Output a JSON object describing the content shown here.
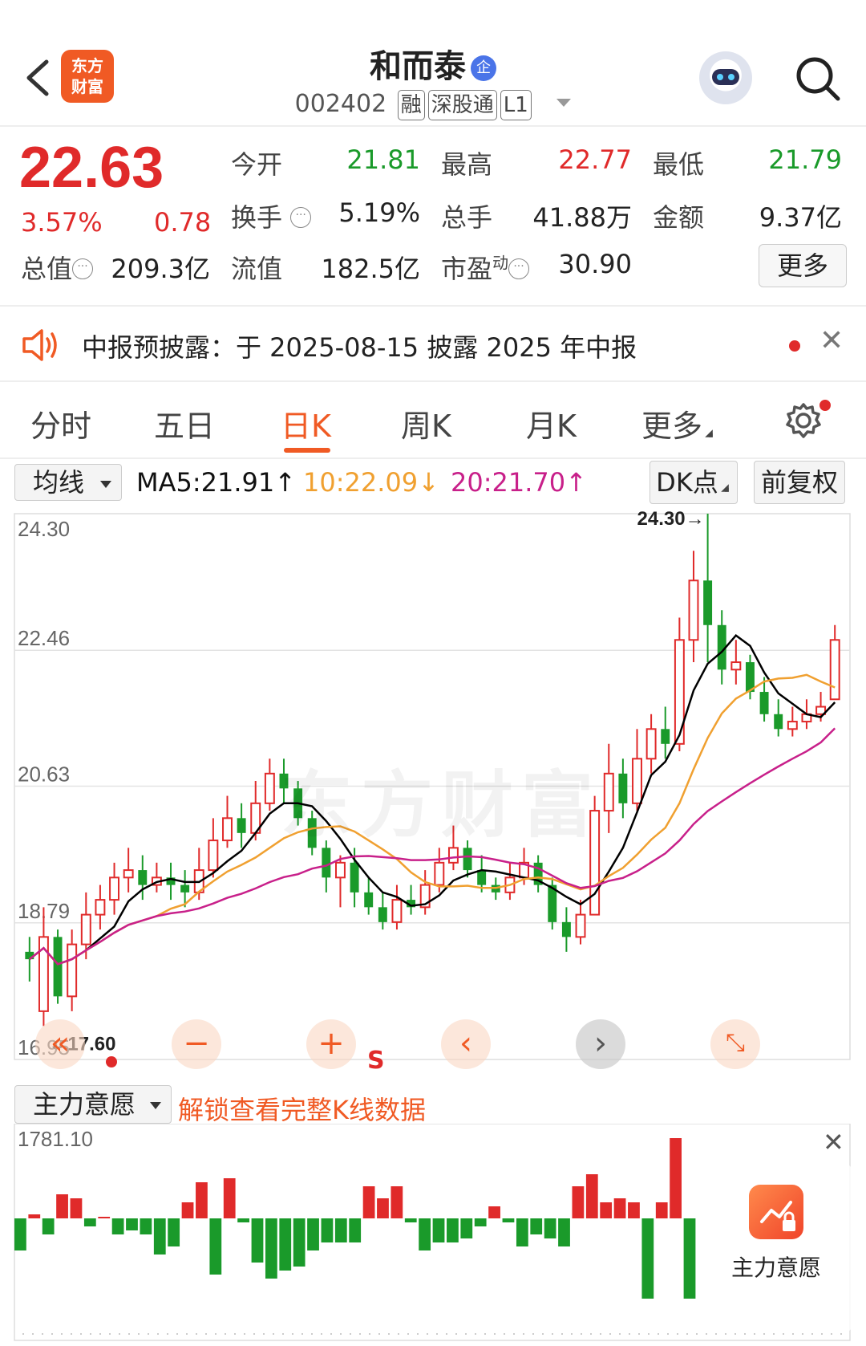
{
  "header": {
    "logo_text": "东方财富",
    "stock_name": "和而泰",
    "qi_badge": "企",
    "code": "002402",
    "tags": [
      "融",
      "深股通",
      "L1"
    ]
  },
  "quote": {
    "price": "22.63",
    "change_pct": "3.57%",
    "change": "0.78",
    "open_label": "今开",
    "open_value": "21.81",
    "high_label": "最高",
    "high_value": "22.77",
    "low_label": "最低",
    "low_value": "21.79",
    "turnover_label": "换手",
    "turnover_value": "5.19%",
    "volume_label": "总手",
    "volume_value": "41.88万",
    "amount_label": "金额",
    "amount_value": "9.37亿",
    "mktcap_label": "总值",
    "mktcap_value": "209.3亿",
    "float_label": "流值",
    "float_value": "182.5亿",
    "pe_label": "市盈",
    "pe_sup": "动",
    "pe_value": "30.90",
    "more_label": "更多",
    "colors": {
      "up": "#e02a2a",
      "down": "#1a9a2a"
    }
  },
  "notice": {
    "text": "中报预披露：于 2025-08-15 披露 2025 年中报"
  },
  "tabs": {
    "items": [
      "分时",
      "五日",
      "日K",
      "周K",
      "月K",
      "更多"
    ],
    "active": "日K",
    "active_color": "#f05a24"
  },
  "ma_bar": {
    "selector": "均线",
    "ma5": "MA5:21.91↑",
    "ma10": "10:22.09↓",
    "ma20": "20:21.70↑",
    "dk_label": "DK点",
    "adjust_label": "前复权",
    "colors": {
      "ma5": "#000000",
      "ma10": "#f0a030",
      "ma20": "#c8208a"
    }
  },
  "chart_data": {
    "type": "candlestick",
    "y_tick_labels": [
      "24.30",
      "22.46",
      "20.63",
      "18.79",
      "16.95"
    ],
    "ylim": [
      16.95,
      24.3
    ],
    "max_annotation": "24.30→",
    "min_annotation": "←17.60",
    "watermark": "东方财富",
    "s_marker": "S",
    "candles": [
      [
        18.4,
        18.3,
        18.6,
        18.0
      ],
      [
        17.6,
        18.6,
        19.0,
        17.4
      ],
      [
        18.6,
        17.8,
        18.7,
        17.7
      ],
      [
        17.8,
        18.5,
        18.7,
        17.6
      ],
      [
        18.5,
        18.9,
        19.2,
        18.3
      ],
      [
        18.9,
        19.1,
        19.3,
        18.7
      ],
      [
        19.1,
        19.4,
        19.6,
        18.9
      ],
      [
        19.4,
        19.5,
        19.8,
        19.2
      ],
      [
        19.5,
        19.3,
        19.7,
        19.1
      ],
      [
        19.3,
        19.4,
        19.6,
        19.2
      ],
      [
        19.4,
        19.3,
        19.6,
        19.1
      ],
      [
        19.3,
        19.2,
        19.5,
        19.0
      ],
      [
        19.2,
        19.5,
        19.8,
        19.1
      ],
      [
        19.5,
        19.9,
        20.2,
        19.4
      ],
      [
        19.9,
        20.2,
        20.5,
        19.8
      ],
      [
        20.2,
        20.0,
        20.4,
        19.8
      ],
      [
        20.0,
        20.4,
        20.7,
        19.9
      ],
      [
        20.4,
        20.8,
        21.0,
        20.3
      ],
      [
        20.8,
        20.6,
        21.0,
        20.4
      ],
      [
        20.6,
        20.2,
        20.7,
        20.1
      ],
      [
        20.2,
        19.8,
        20.3,
        19.7
      ],
      [
        19.8,
        19.4,
        19.9,
        19.2
      ],
      [
        19.4,
        19.6,
        19.7,
        19.0
      ],
      [
        19.6,
        19.2,
        19.8,
        19.0
      ],
      [
        19.2,
        19.0,
        19.4,
        18.9
      ],
      [
        19.0,
        18.8,
        19.2,
        18.7
      ],
      [
        18.8,
        19.1,
        19.3,
        18.7
      ],
      [
        19.1,
        19.0,
        19.3,
        18.9
      ],
      [
        19.0,
        19.3,
        19.5,
        18.9
      ],
      [
        19.3,
        19.6,
        19.8,
        19.2
      ],
      [
        19.6,
        19.8,
        20.1,
        19.5
      ],
      [
        19.8,
        19.5,
        19.9,
        19.4
      ],
      [
        19.5,
        19.3,
        19.7,
        19.2
      ],
      [
        19.3,
        19.2,
        19.4,
        19.1
      ],
      [
        19.2,
        19.4,
        19.6,
        19.1
      ],
      [
        19.4,
        19.6,
        19.8,
        19.3
      ],
      [
        19.6,
        19.3,
        19.7,
        19.2
      ],
      [
        19.3,
        18.8,
        19.4,
        18.7
      ],
      [
        18.8,
        18.6,
        19.0,
        18.4
      ],
      [
        18.6,
        18.9,
        19.1,
        18.5
      ],
      [
        18.9,
        20.3,
        20.5,
        18.9
      ],
      [
        20.3,
        20.8,
        21.2,
        20.0
      ],
      [
        20.8,
        20.4,
        21.0,
        20.2
      ],
      [
        20.4,
        21.0,
        21.4,
        20.3
      ],
      [
        21.0,
        21.4,
        21.6,
        20.8
      ],
      [
        21.4,
        21.2,
        21.7,
        21.0
      ],
      [
        21.2,
        22.6,
        22.9,
        21.1
      ],
      [
        22.6,
        23.4,
        23.8,
        22.3
      ],
      [
        23.4,
        22.8,
        24.3,
        22.3
      ],
      [
        22.8,
        22.2,
        23.0,
        22.0
      ],
      [
        22.2,
        22.3,
        22.6,
        22.0
      ],
      [
        22.3,
        21.9,
        22.4,
        21.8
      ],
      [
        21.9,
        21.6,
        22.1,
        21.5
      ],
      [
        21.6,
        21.4,
        21.8,
        21.3
      ],
      [
        21.4,
        21.5,
        21.7,
        21.3
      ],
      [
        21.5,
        21.6,
        21.8,
        21.4
      ],
      [
        21.6,
        21.7,
        21.9,
        21.5
      ],
      [
        21.8,
        22.6,
        22.8,
        21.8
      ]
    ]
  },
  "indicator": {
    "selector": "主力意愿",
    "unlock_text": "解锁查看完整K线数据",
    "max_label": "1781.10",
    "panel_label": "主力意愿",
    "values": [
      -40,
      5,
      -20,
      30,
      25,
      -10,
      2,
      -20,
      -15,
      -20,
      -45,
      -35,
      20,
      45,
      -70,
      50,
      -5,
      -55,
      -75,
      -65,
      -60,
      -40,
      -30,
      -30,
      -30,
      40,
      25,
      40,
      -5,
      -40,
      -30,
      -30,
      -25,
      -10,
      15,
      -5,
      -35,
      -20,
      -25,
      -35,
      40,
      55,
      20,
      25,
      20,
      -100,
      20,
      100,
      -100
    ]
  }
}
